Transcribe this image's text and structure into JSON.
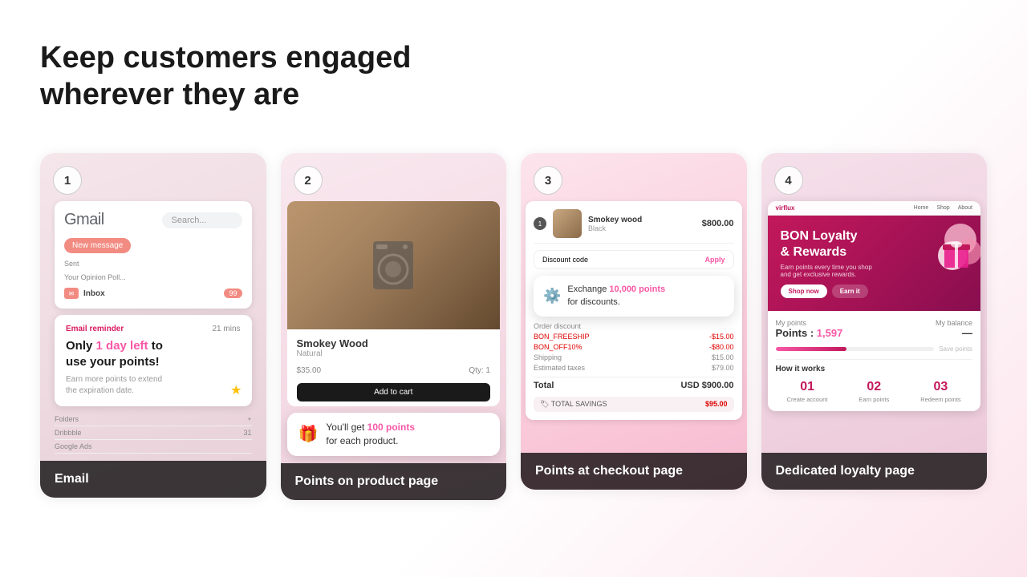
{
  "heading": {
    "line1": "Keep customers engaged",
    "line2": "wherever they are"
  },
  "cards": [
    {
      "number": "1",
      "label": "Email",
      "gmail": {
        "logo": "Gmail",
        "search_placeholder": "Search...",
        "compose": "New message",
        "rows": [
          "Sent",
          "Your Opinion Poll..."
        ],
        "inbox": "Inbox",
        "inbox_count": "99"
      },
      "reminder": {
        "tag": "Email reminder",
        "time": "21 mins",
        "title_pre": "Only ",
        "title_highlight": "1 day left",
        "title_post": " to\nuse your points!",
        "description": "Earn more points to extend\nthe expiration date."
      },
      "bottom_labels": [
        "Folders",
        "Dribbble",
        "Google Ads"
      ]
    },
    {
      "number": "2",
      "label": "Points on product page",
      "product": {
        "name": "Smokey Wood",
        "sub": "Natural",
        "price": "$35.00",
        "qty": "1"
      },
      "tooltip": {
        "icon": "🎁",
        "pre": "You'll get ",
        "highlight": "100 points",
        "post": " for each product."
      }
    },
    {
      "number": "3",
      "label": "Points at checkout page",
      "product": {
        "name": "Smokey wood",
        "sub": "Black",
        "price": "$800.00",
        "badge": "1"
      },
      "discount_label": "Discount code",
      "apply": "Apply",
      "exchange_tooltip": {
        "pre": "Exchange ",
        "highlight": "10,000 points",
        "post": " for discounts."
      },
      "order_discount": "Order discount",
      "bon_free_ship": "BON_FREESHIP",
      "bon_free_ship_val": "-$15.00",
      "bon_off10": "BON_OFF10%",
      "bon_off10_val": "-$80.00",
      "shipping": "Shipping",
      "shipping_val": "$15.00",
      "taxes": "Estimated taxes",
      "taxes_val": "$79.00",
      "total": "Total",
      "total_currency": "USD",
      "total_val": "$900.00",
      "savings": "TOTAL SAVINGS",
      "savings_val": "$95.00"
    },
    {
      "number": "4",
      "label": "Dedicated loyalty page",
      "bon_logo": "virflux",
      "nav_items": [
        "Home",
        "Shop",
        "About"
      ],
      "hero_title": "BON Loyalty\n& Rewards",
      "hero_subtitle": "Earn points every time you shop and get exclusive rewards.",
      "btn1": "Shop now",
      "btn2": "Earn it",
      "points_label": "My points",
      "points_value": "1,597",
      "progress_label": "Save points",
      "balance_label": "My balance",
      "how_it_works": "How it works",
      "steps": [
        {
          "num": "01",
          "label": "Create account"
        },
        {
          "num": "02",
          "label": "Earn points"
        },
        {
          "num": "03",
          "label": "Redeem points"
        }
      ]
    }
  ]
}
